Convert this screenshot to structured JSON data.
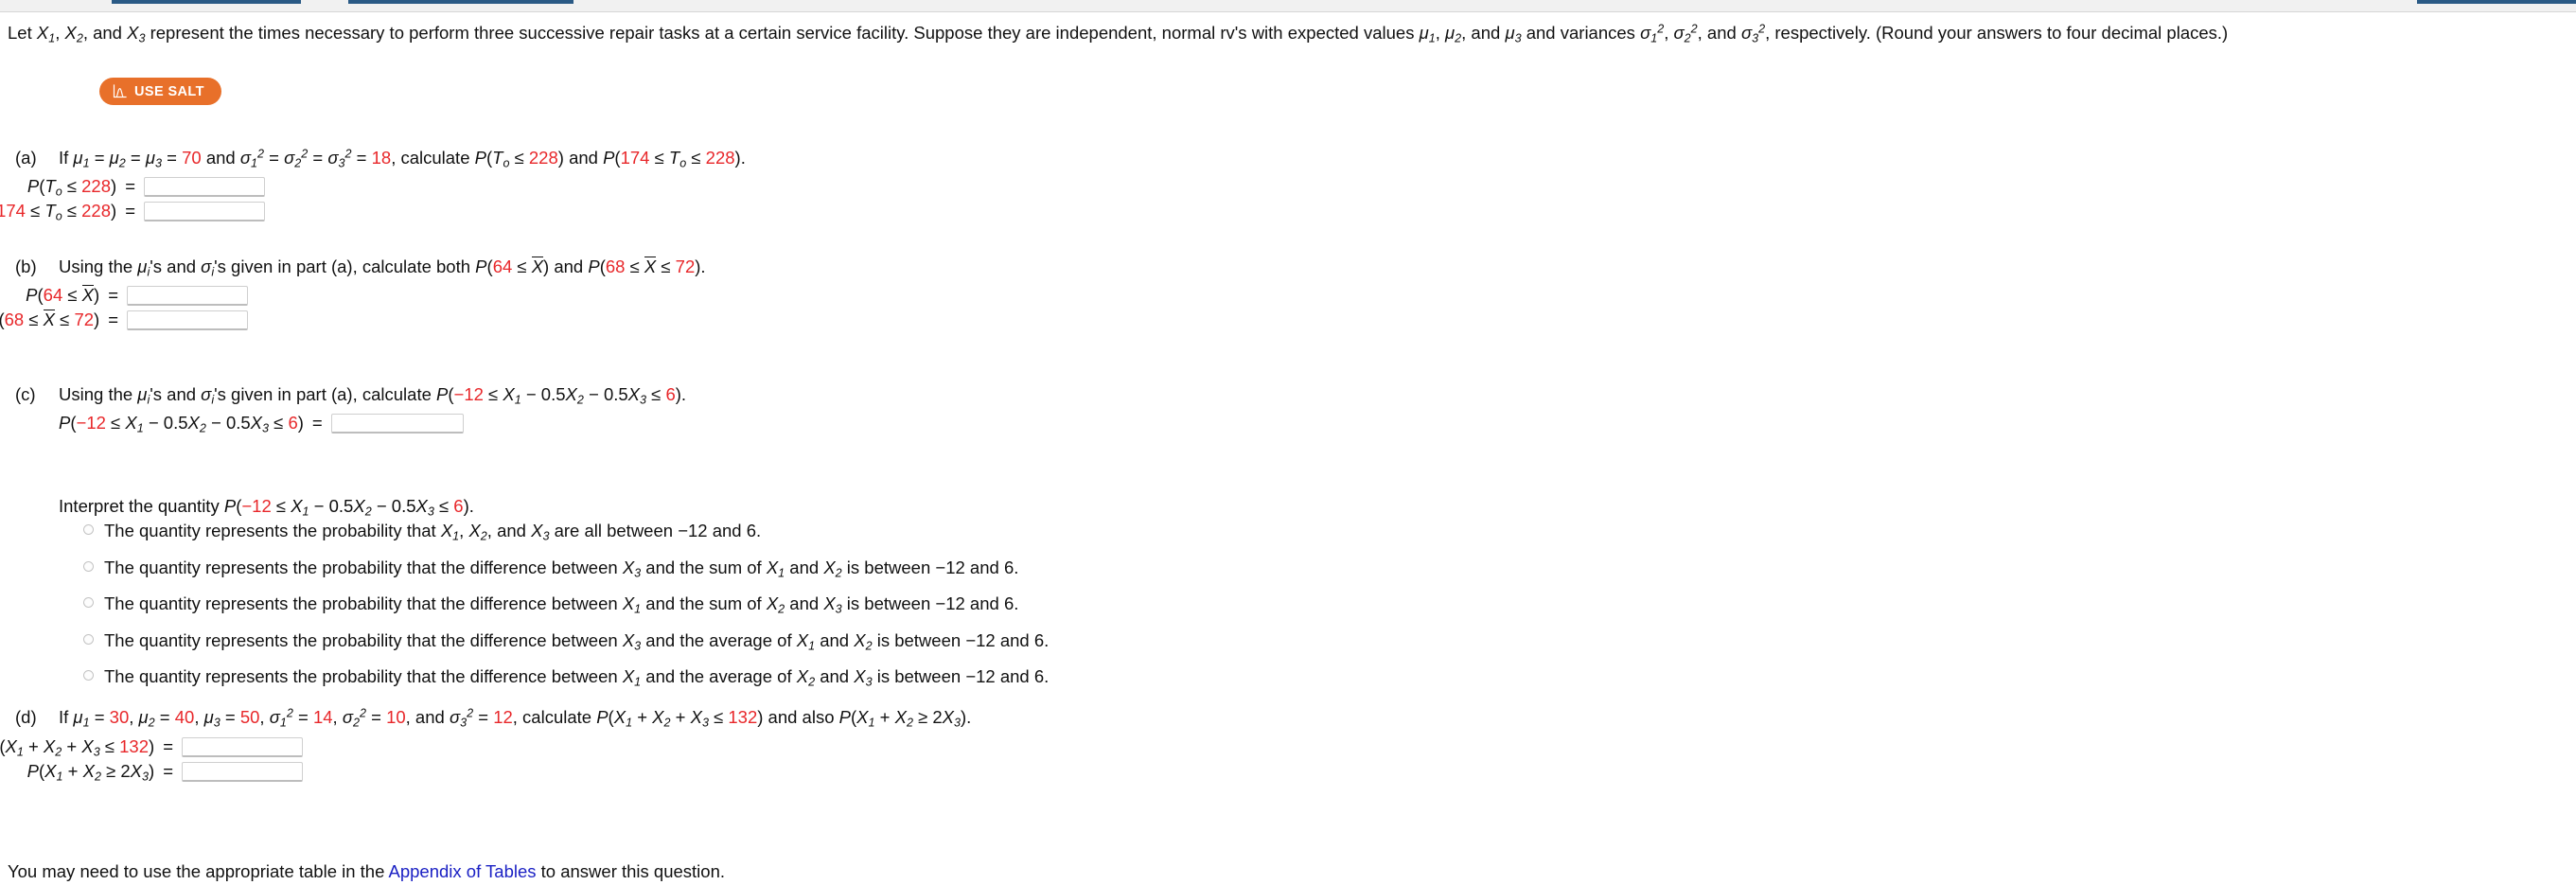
{
  "browser": {
    "tab_fragment_color": "#2a5a85"
  },
  "colors": {
    "accent_orange": "#e8702a",
    "value_red": "#e8272a",
    "link_blue": "#1b21c4"
  },
  "intro": {
    "text_1": "Let ",
    "text_2": " represent the times necessary to perform three successive repair tasks at a certain service facility. Suppose they are independent, normal rv's with expected values ",
    "text_3": " and variances ",
    "text_4": ", respectively. (Round your answers to four decimal places.)"
  },
  "salt_button": {
    "label": "USE SALT",
    "icon": "distribution-curve-icon"
  },
  "parts": {
    "a": {
      "label": "(a)",
      "mu_value": "70",
      "sigma_value": "18",
      "t_upper": "228",
      "t_lower": "174",
      "answers": [
        {
          "name": "prob-t-le-228",
          "value": "",
          "placeholder": ""
        },
        {
          "name": "prob-174-le-t-le-228",
          "value": "",
          "placeholder": ""
        }
      ]
    },
    "b": {
      "label": "(b)",
      "lead": "Using the ",
      "mid": "'s and ",
      "mid2": "'s given in part (a), calculate both ",
      "v1": "64",
      "v2": "68",
      "v3": "72",
      "answers": [
        {
          "name": "prob-64-le-xbar",
          "value": "",
          "placeholder": ""
        },
        {
          "name": "prob-68-le-xbar-le-72",
          "value": "",
          "placeholder": ""
        }
      ]
    },
    "c": {
      "label": "(c)",
      "lead": "Using the ",
      "mid": "'s and ",
      "mid2": "'s given in part (a), calculate ",
      "low": "−12",
      "high": "6",
      "coef": "0.5",
      "answer": {
        "name": "prob-linear-combination",
        "value": "",
        "placeholder": ""
      },
      "interpret_lead": "Interpret the quantity ",
      "options": [
        {
          "id": "opt-all-between",
          "pre": "The quantity represents the probability that ",
          "mid": " are all between ",
          "kind": "all-three",
          "low": "−12",
          "high": "6"
        },
        {
          "id": "opt-x3-sum-x1-x2",
          "pre": "The quantity represents the probability that the difference between ",
          "target": "3",
          "rel": " and the sum of ",
          "a": "1",
          "b": "2",
          "post": " is between ",
          "low": "−12",
          "high": "6"
        },
        {
          "id": "opt-x1-sum-x2-x3",
          "pre": "The quantity represents the probability that the difference between ",
          "target": "1",
          "rel": " and the sum of ",
          "a": "2",
          "b": "3",
          "post": " is between ",
          "low": "−12",
          "high": "6"
        },
        {
          "id": "opt-x3-avg-x1-x2",
          "pre": "The quantity represents the probability that the difference between ",
          "target": "3",
          "rel": " and the average of ",
          "a": "1",
          "b": "2",
          "post": " is between ",
          "low": "−12",
          "high": "6"
        },
        {
          "id": "opt-x1-avg-x2-x3",
          "pre": "The quantity represents the probability that the difference between ",
          "target": "1",
          "rel": " and the average of ",
          "a": "2",
          "b": "3",
          "post": " is between ",
          "low": "−12",
          "high": "6"
        }
      ]
    },
    "d": {
      "label": "(d)",
      "mu1": "30",
      "mu2": "40",
      "mu3": "50",
      "sigma1": "14",
      "sigma2": "10",
      "sigma3": "12",
      "sum_bound": "132",
      "answers": [
        {
          "name": "prob-sum-le-132",
          "value": "",
          "placeholder": ""
        },
        {
          "name": "prob-x1-x2-ge-2x3",
          "value": "",
          "placeholder": ""
        }
      ]
    }
  },
  "footer": {
    "before_link": "You may need to use the appropriate table in the ",
    "link_text": "Appendix of Tables",
    "after_link": " to answer this question."
  }
}
